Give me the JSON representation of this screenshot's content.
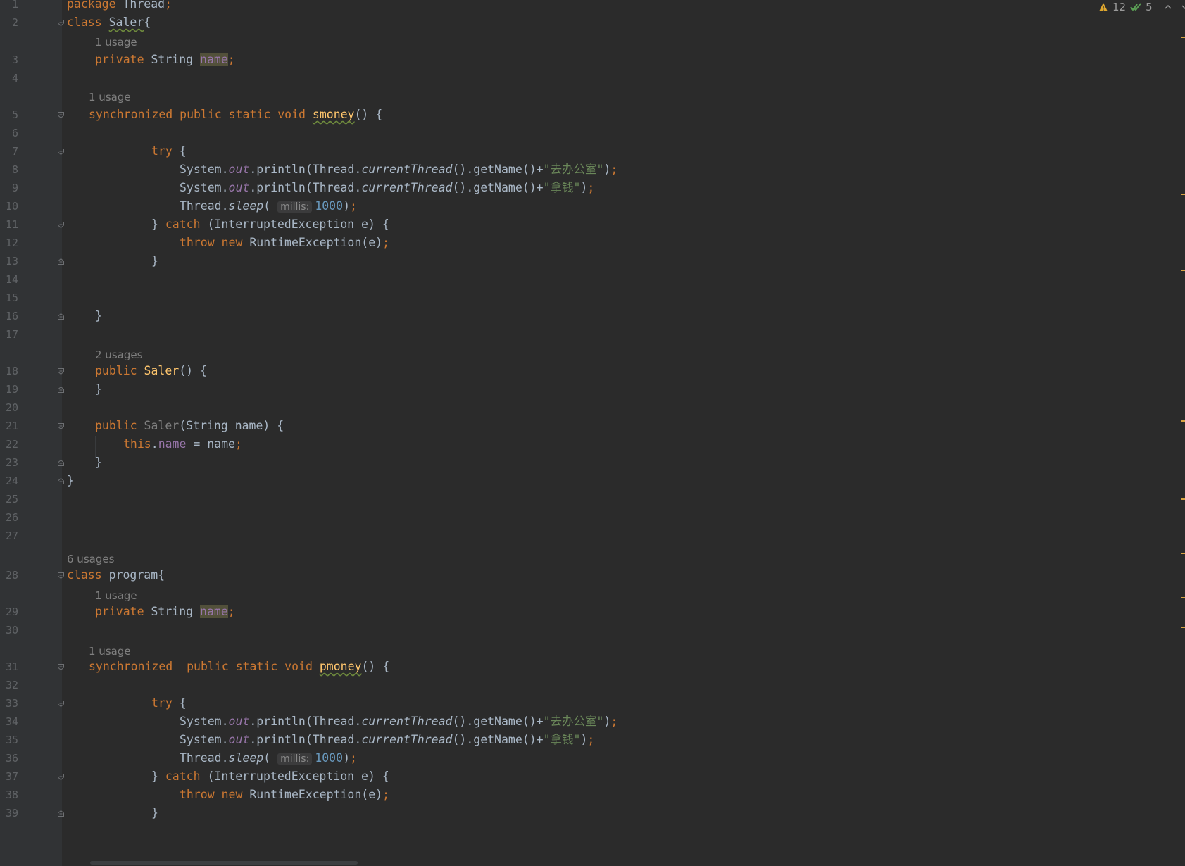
{
  "inspection": {
    "warnings_count": "12",
    "ok_count": "5"
  },
  "colors": {
    "background": "#2b2b2b",
    "keyword": "#cc7832",
    "method": "#ffc66d",
    "field": "#9876aa",
    "string": "#6a8759",
    "number": "#6897bb",
    "text": "#a9b7c6",
    "comment_hint": "#808080"
  },
  "gutter": {
    "line_numbers": [
      "1",
      "2",
      "3",
      "4",
      "5",
      "6",
      "7",
      "8",
      "9",
      "10",
      "11",
      "12",
      "13",
      "14",
      "15",
      "16",
      "17",
      "18",
      "19",
      "20",
      "21",
      "22",
      "23",
      "24",
      "25",
      "26",
      "27",
      "28",
      "29",
      "30",
      "31",
      "32",
      "33",
      "34",
      "35",
      "36",
      "37",
      "38",
      "39"
    ]
  },
  "usages": {
    "u2": "1 usage",
    "u4": "1 usage",
    "u17": "2 usages",
    "u27": "6 usages",
    "u28": "1 usage",
    "u30": "1 usage"
  },
  "code": {
    "l1": {
      "kw": "package",
      "name": "Thread",
      "semi": ";"
    },
    "l2": {
      "kw": "class",
      "cls": "Saler",
      "brace": "{"
    },
    "l3": {
      "kw": "private",
      "type": "String",
      "field": "name",
      "semi": ";"
    },
    "l5": {
      "kw": "synchronized public static void",
      "method": "smoney",
      "rest": "() {"
    },
    "l7": {
      "kw": "try",
      "rest": "{"
    },
    "l8": {
      "a": "System.",
      "out": "out",
      "b": ".println(Thread.",
      "ct": "currentThread",
      "c": "().getName()+",
      "str": "\"去办公室\"",
      "d": ")",
      "semi": ";"
    },
    "l9": {
      "a": "System.",
      "out": "out",
      "b": ".println(Thread.",
      "ct": "currentThread",
      "c": "().getName()+",
      "str": "\"拿钱\"",
      "d": ")",
      "semi": ";"
    },
    "l10": {
      "a": "Thread.",
      "sleep": "sleep",
      "b": "(",
      "hint": "millis:",
      "num": "1000",
      "c": ")",
      "semi": ";"
    },
    "l11": {
      "a": "}",
      "kw": "catch",
      "b": "(InterruptedException e) {"
    },
    "l12": {
      "kw": "throw new",
      "b": "RuntimeException(e)",
      "semi": ";"
    },
    "l13": {
      "a": "}"
    },
    "l16": {
      "a": "}"
    },
    "l18": {
      "kw": "public",
      "method": "Saler",
      "rest": "() {"
    },
    "l19": {
      "a": "}"
    },
    "l21": {
      "kw": "public",
      "ctor": "Saler",
      "rest": "(String name) {"
    },
    "l22": {
      "kw": "this",
      "dot": ".",
      "field": "name",
      "rest": "= name",
      "semi": ";"
    },
    "l23": {
      "a": "}"
    },
    "l24": {
      "a": "}"
    },
    "l28": {
      "kw": "class",
      "cls": "program",
      "brace": "{"
    },
    "l29": {
      "kw": "private",
      "type": "String",
      "field": "name",
      "semi": ";"
    },
    "l31": {
      "kw": "synchronized  public static void",
      "method": "pmoney",
      "rest": "() {"
    },
    "l33": {
      "kw": "try",
      "rest": "{"
    },
    "l34": {
      "a": "System.",
      "out": "out",
      "b": ".println(Thread.",
      "ct": "currentThread",
      "c": "().getName()+",
      "str": "\"去办公室\"",
      "d": ")",
      "semi": ";"
    },
    "l35": {
      "a": "System.",
      "out": "out",
      "b": ".println(Thread.",
      "ct": "currentThread",
      "c": "().getName()+",
      "str": "\"拿钱\"",
      "d": ")",
      "semi": ";"
    },
    "l36": {
      "a": "Thread.",
      "sleep": "sleep",
      "b": "(",
      "hint": "millis:",
      "num": "1000",
      "c": ")",
      "semi": ";"
    },
    "l37": {
      "a": "}",
      "kw": "catch",
      "b": "(InterruptedException e) {"
    },
    "l38": {
      "kw": "throw new",
      "b": "RuntimeException(e)",
      "semi": ";"
    },
    "l39": {
      "a": "}"
    }
  }
}
